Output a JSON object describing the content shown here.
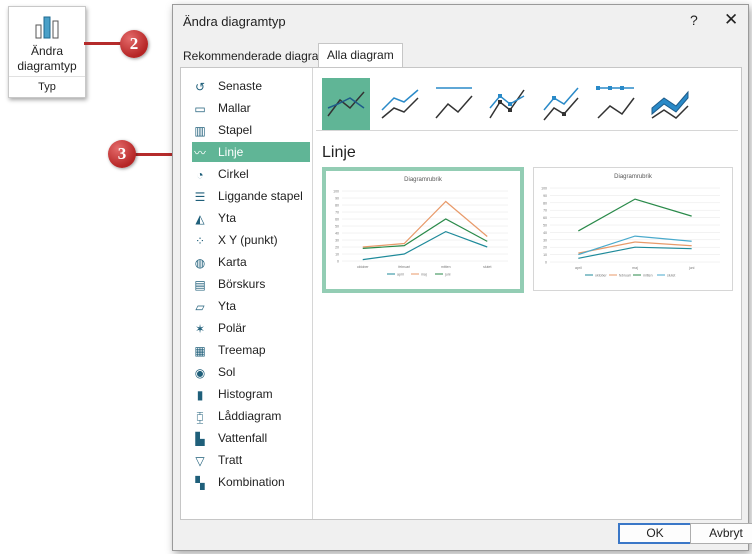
{
  "ribbon": {
    "label_line1": "Ändra",
    "label_line2": "diagramtyp",
    "group": "Typ"
  },
  "callouts": {
    "step_a": "2",
    "step_b": "3"
  },
  "dialog": {
    "title": "Ändra diagramtyp",
    "help": "?",
    "close": "✕",
    "tabs": [
      "Rekommenderade diagram",
      "Alla diagram"
    ],
    "sidebar": [
      {
        "label": "Senaste",
        "icon": "recent-icon"
      },
      {
        "label": "Mallar",
        "icon": "folder-icon"
      },
      {
        "label": "Stapel",
        "icon": "column-chart-icon"
      },
      {
        "label": "Linje",
        "icon": "line-chart-icon"
      },
      {
        "label": "Cirkel",
        "icon": "pie-chart-icon"
      },
      {
        "label": "Liggande stapel",
        "icon": "bar-chart-icon"
      },
      {
        "label": "Yta",
        "icon": "area-chart-icon"
      },
      {
        "label": "X Y (punkt)",
        "icon": "scatter-chart-icon"
      },
      {
        "label": "Karta",
        "icon": "map-chart-icon"
      },
      {
        "label": "Börskurs",
        "icon": "stock-chart-icon"
      },
      {
        "label": "Yta",
        "icon": "surface-chart-icon"
      },
      {
        "label": "Polär",
        "icon": "radar-chart-icon"
      },
      {
        "label": "Treemap",
        "icon": "treemap-icon"
      },
      {
        "label": "Sol",
        "icon": "sunburst-icon"
      },
      {
        "label": "Histogram",
        "icon": "histogram-icon"
      },
      {
        "label": "Låddiagram",
        "icon": "box-whisker-icon"
      },
      {
        "label": "Vattenfall",
        "icon": "waterfall-icon"
      },
      {
        "label": "Tratt",
        "icon": "funnel-icon"
      },
      {
        "label": "Kombination",
        "icon": "combo-chart-icon"
      }
    ],
    "selected_type": "Linje",
    "section_title": "Linje",
    "ok": "OK",
    "cancel": "Avbryt",
    "colors": {
      "accent": "#60b596",
      "accent_light": "#93cdb4"
    }
  },
  "chart_data": [
    {
      "type": "line",
      "title": "Diagramrubrik",
      "categories": [
        "oktober",
        "februari",
        "mitten",
        "slutet"
      ],
      "series": [
        {
          "name": "april",
          "values": [
            2,
            10,
            42,
            20
          ],
          "color": "#1e8a9a"
        },
        {
          "name": "maj",
          "values": [
            20,
            25,
            85,
            35
          ],
          "color": "#e89a6a"
        },
        {
          "name": "juni",
          "values": [
            18,
            22,
            60,
            28
          ],
          "color": "#2a8a4a"
        }
      ],
      "ylim": [
        0,
        100
      ],
      "yticks": [
        0,
        10,
        20,
        30,
        40,
        50,
        60,
        70,
        80,
        90,
        100
      ],
      "legend": "bottom"
    },
    {
      "type": "line",
      "title": "Diagramrubrik",
      "categories": [
        "april",
        "maj",
        "juni"
      ],
      "series": [
        {
          "name": "oktober",
          "values": [
            5,
            20,
            18
          ],
          "color": "#1e8a9a"
        },
        {
          "name": "februari",
          "values": [
            12,
            27,
            22
          ],
          "color": "#e89a6a"
        },
        {
          "name": "mitten",
          "values": [
            42,
            85,
            62
          ],
          "color": "#2a8a4a"
        },
        {
          "name": "slutet",
          "values": [
            10,
            35,
            28
          ],
          "color": "#4aaacc"
        }
      ],
      "ylim": [
        0,
        100
      ],
      "yticks": [
        0,
        10,
        20,
        30,
        40,
        50,
        60,
        70,
        80,
        90,
        100
      ],
      "legend": "bottom"
    }
  ]
}
